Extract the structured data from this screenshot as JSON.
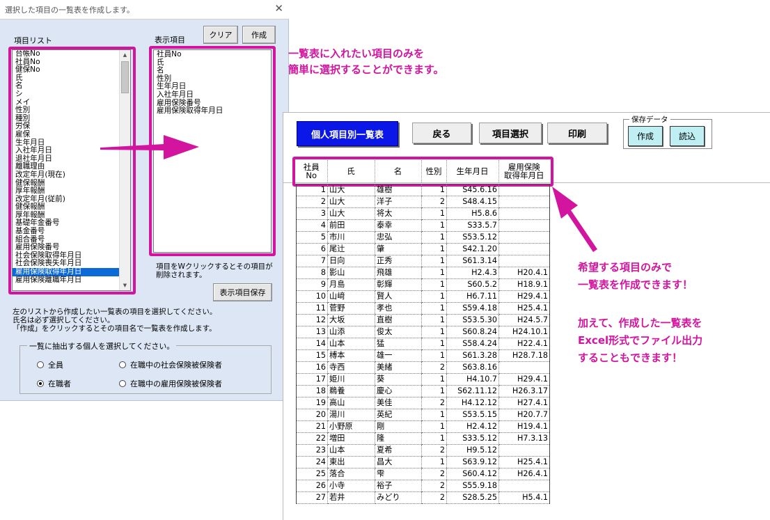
{
  "dialog": {
    "title": "選択した項目の一覧表を作成します。",
    "close_glyph": "✕",
    "item_list_label": "項目リスト",
    "display_items_label": "表示項目",
    "clear_button": "クリア",
    "create_button": "作成",
    "item_list": [
      "台帳No",
      "社員No",
      "健保No",
      "氏",
      "名",
      "シ",
      "メイ",
      "性別",
      "種別",
      "労保",
      "雇保",
      "生年月日",
      "入社年月日",
      "退社年月日",
      "離職理由",
      "改定年月(現在)",
      "健保報酬",
      "厚年報酬",
      "改定年月(従前)",
      "健保報酬",
      "厚年報酬",
      "基礎年金番号",
      "基金番号",
      "組合番号",
      "雇用保険番号",
      "社会保険取得年月日",
      "社会保険喪失年月日",
      "雇用保険取得年月日",
      "雇用保険離職年月日"
    ],
    "item_list_selected": "雇用保険取得年月日",
    "display_items": [
      "社員No",
      "氏",
      "名",
      "性別",
      "生年月日",
      "入社年月日",
      "雇用保険番号",
      "雇用保険取得年月日"
    ],
    "dblclick_note_1": "項目をWクリックするとその項目が",
    "dblclick_note_2": "削除されます。",
    "save_display_button": "表示項目保存",
    "instruction_1": "左のリストから作成したい一覧表の項目を選択してください。",
    "instruction_2": "氏名は必ず選択してください。",
    "instruction_3": "「作成」をクリックするとその項目名で一覧表を作成します。",
    "group_title": "一覧に抽出する個人を選択してください。",
    "radio_all": "全員",
    "radio_employed": "在職者",
    "radio_social_insured": "在職中の社会保険被保険者",
    "radio_employment_insured": "在職中の雇用保険被保険者",
    "radio_selected": "employed"
  },
  "callouts": {
    "top_1": "一覧表に入れたい項目のみを",
    "top_2": "簡単に選択することができます。",
    "right_1": "希望する項目のみで",
    "right_2": "一覧表を作成できます！",
    "right_3": "加えて、作成した一覧表を",
    "right_4": "Excel形式でファイル出力",
    "right_5": "することもできます！"
  },
  "sheet": {
    "title_button": "個人項目別一覧表",
    "back_button": "戻る",
    "select_button": "項目選択",
    "print_button": "印刷",
    "save_data_label": "保存データ",
    "save_create_button": "作成",
    "save_load_button": "読込",
    "headers": {
      "no_1": "社員",
      "no_2": "No",
      "last": "氏",
      "first": "名",
      "gender": "性別",
      "birth": "生年月日",
      "ei_1": "雇用保険",
      "ei_2": "取得年月日"
    },
    "rows": [
      [
        "1",
        "山大",
        "雄樹",
        "1",
        "S45.6.16",
        ""
      ],
      [
        "2",
        "山大",
        "洋子",
        "2",
        "S48.4.15",
        ""
      ],
      [
        "3",
        "山大",
        "将太",
        "1",
        "H5.8.6",
        ""
      ],
      [
        "4",
        "前田",
        "泰幸",
        "1",
        "S33.5.7",
        ""
      ],
      [
        "5",
        "市川",
        "忠弘",
        "1",
        "S53.5.12",
        ""
      ],
      [
        "6",
        "尾辻",
        "肇",
        "1",
        "S42.1.20",
        ""
      ],
      [
        "7",
        "日向",
        "正秀",
        "1",
        "S61.3.14",
        ""
      ],
      [
        "8",
        "影山",
        "飛雄",
        "1",
        "H2.4.3",
        "H20.4.1"
      ],
      [
        "9",
        "月島",
        "彰輝",
        "1",
        "S60.5.2",
        "H18.9.1"
      ],
      [
        "10",
        "山﨑",
        "賢人",
        "1",
        "H6.7.11",
        "H29.4.1"
      ],
      [
        "11",
        "菅野",
        "孝也",
        "1",
        "S59.4.18",
        "H25.4.1"
      ],
      [
        "12",
        "大坂",
        "直樹",
        "1",
        "S53.5.30",
        "H24.5.7"
      ],
      [
        "13",
        "山添",
        "俊太",
        "1",
        "S60.8.24",
        "H24.10.1"
      ],
      [
        "14",
        "山本",
        "猛",
        "1",
        "S58.4.24",
        "H22.4.1"
      ],
      [
        "15",
        "榑本",
        "雄一",
        "1",
        "S61.3.28",
        "H28.7.18"
      ],
      [
        "16",
        "寺西",
        "美緒",
        "2",
        "S63.8.16",
        ""
      ],
      [
        "17",
        "姫川",
        "葵",
        "1",
        "H4.10.7",
        "H29.4.1"
      ],
      [
        "18",
        "鵜養",
        "慶心",
        "1",
        "S62.11.12",
        "H26.3.17"
      ],
      [
        "19",
        "高山",
        "美佳",
        "2",
        "H4.12.12",
        "H27.4.1"
      ],
      [
        "20",
        "湯川",
        "英紀",
        "1",
        "S53.5.15",
        "H20.7.7"
      ],
      [
        "21",
        "小野原",
        "剛",
        "1",
        "H2.4.12",
        "H19.4.1"
      ],
      [
        "22",
        "増田",
        "隆",
        "1",
        "S33.5.12",
        "H7.3.13"
      ],
      [
        "23",
        "山本",
        "夏希",
        "2",
        "H9.5.12",
        ""
      ],
      [
        "24",
        "東出",
        "昌大",
        "1",
        "S63.9.12",
        "H25.4.1"
      ],
      [
        "25",
        "落合",
        "雫",
        "2",
        "S60.4.12",
        "H26.4.1"
      ],
      [
        "26",
        "小寺",
        "裕子",
        "2",
        "S55.9.18",
        ""
      ],
      [
        "27",
        "若井",
        "みどり",
        "2",
        "S28.5.25",
        "H5.4.1"
      ]
    ]
  }
}
